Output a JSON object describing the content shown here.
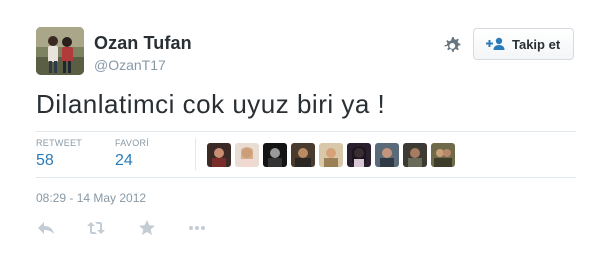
{
  "user": {
    "full_name": "Ozan Tufan",
    "handle": "@OzanT17"
  },
  "follow_button": {
    "label": "Takip et",
    "icon": "follow-user-icon"
  },
  "settings_icon": "gear-icon",
  "tweet": {
    "text": "Dilanlatimci cok uyuz biri ya !",
    "timestamp": "08:29 - 14 May 2012"
  },
  "stats": {
    "retweet_label": "RETWEET",
    "retweet_count": "58",
    "favorite_label": "FAVORİ",
    "favorite_count": "24"
  },
  "favoriters_shown": 9,
  "actions": [
    "reply-icon",
    "retweet-icon",
    "favorite-star-icon",
    "more-dots-icon"
  ],
  "colors": {
    "name_text": "#292f33",
    "muted_text": "#8899a6",
    "link_blue": "#2b7bb9",
    "divider": "#e1e8ed",
    "action_icon": "#c4cdd5",
    "follow_icon": "#2b7bb9"
  }
}
